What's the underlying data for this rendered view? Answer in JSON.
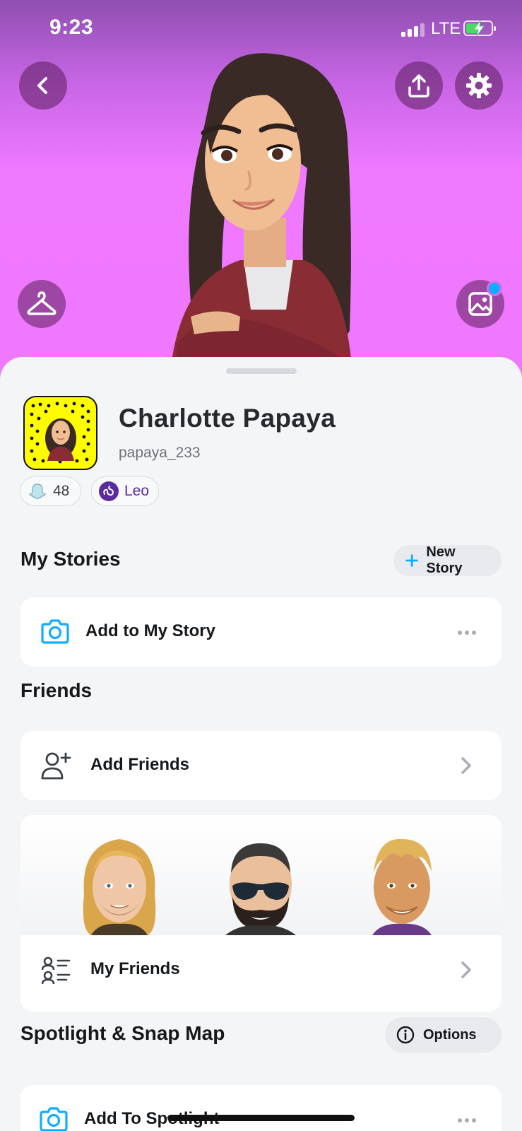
{
  "status_bar": {
    "time": "9:23",
    "network": "LTE"
  },
  "header": {
    "back_icon": "chevron-left-icon",
    "share_icon": "upload-icon",
    "settings_icon": "gear-icon",
    "outfit_icon": "hanger-icon",
    "backgrounds_icon": "image-icon"
  },
  "profile": {
    "name": "Charlotte Papaya",
    "username": "papaya_233",
    "snap_score": "48",
    "zodiac": "Leo"
  },
  "stories": {
    "title": "My Stories",
    "new_story_label": "New Story",
    "add_story_label": "Add to My Story"
  },
  "friends": {
    "title": "Friends",
    "add_friends_label": "Add Friends",
    "my_friends_label": "My Friends"
  },
  "spotlight": {
    "title": "Spotlight & Snap Map",
    "options_label": "Options",
    "add_spotlight_label": "Add To Spotlight"
  },
  "colors": {
    "accent_blue": "#0fadff",
    "snapcode_yellow": "#fffc00",
    "zodiac_purple": "#5a2aa0",
    "hero_gradient_top": "#8f4fb0",
    "hero_gradient_bottom": "#f078ff"
  }
}
